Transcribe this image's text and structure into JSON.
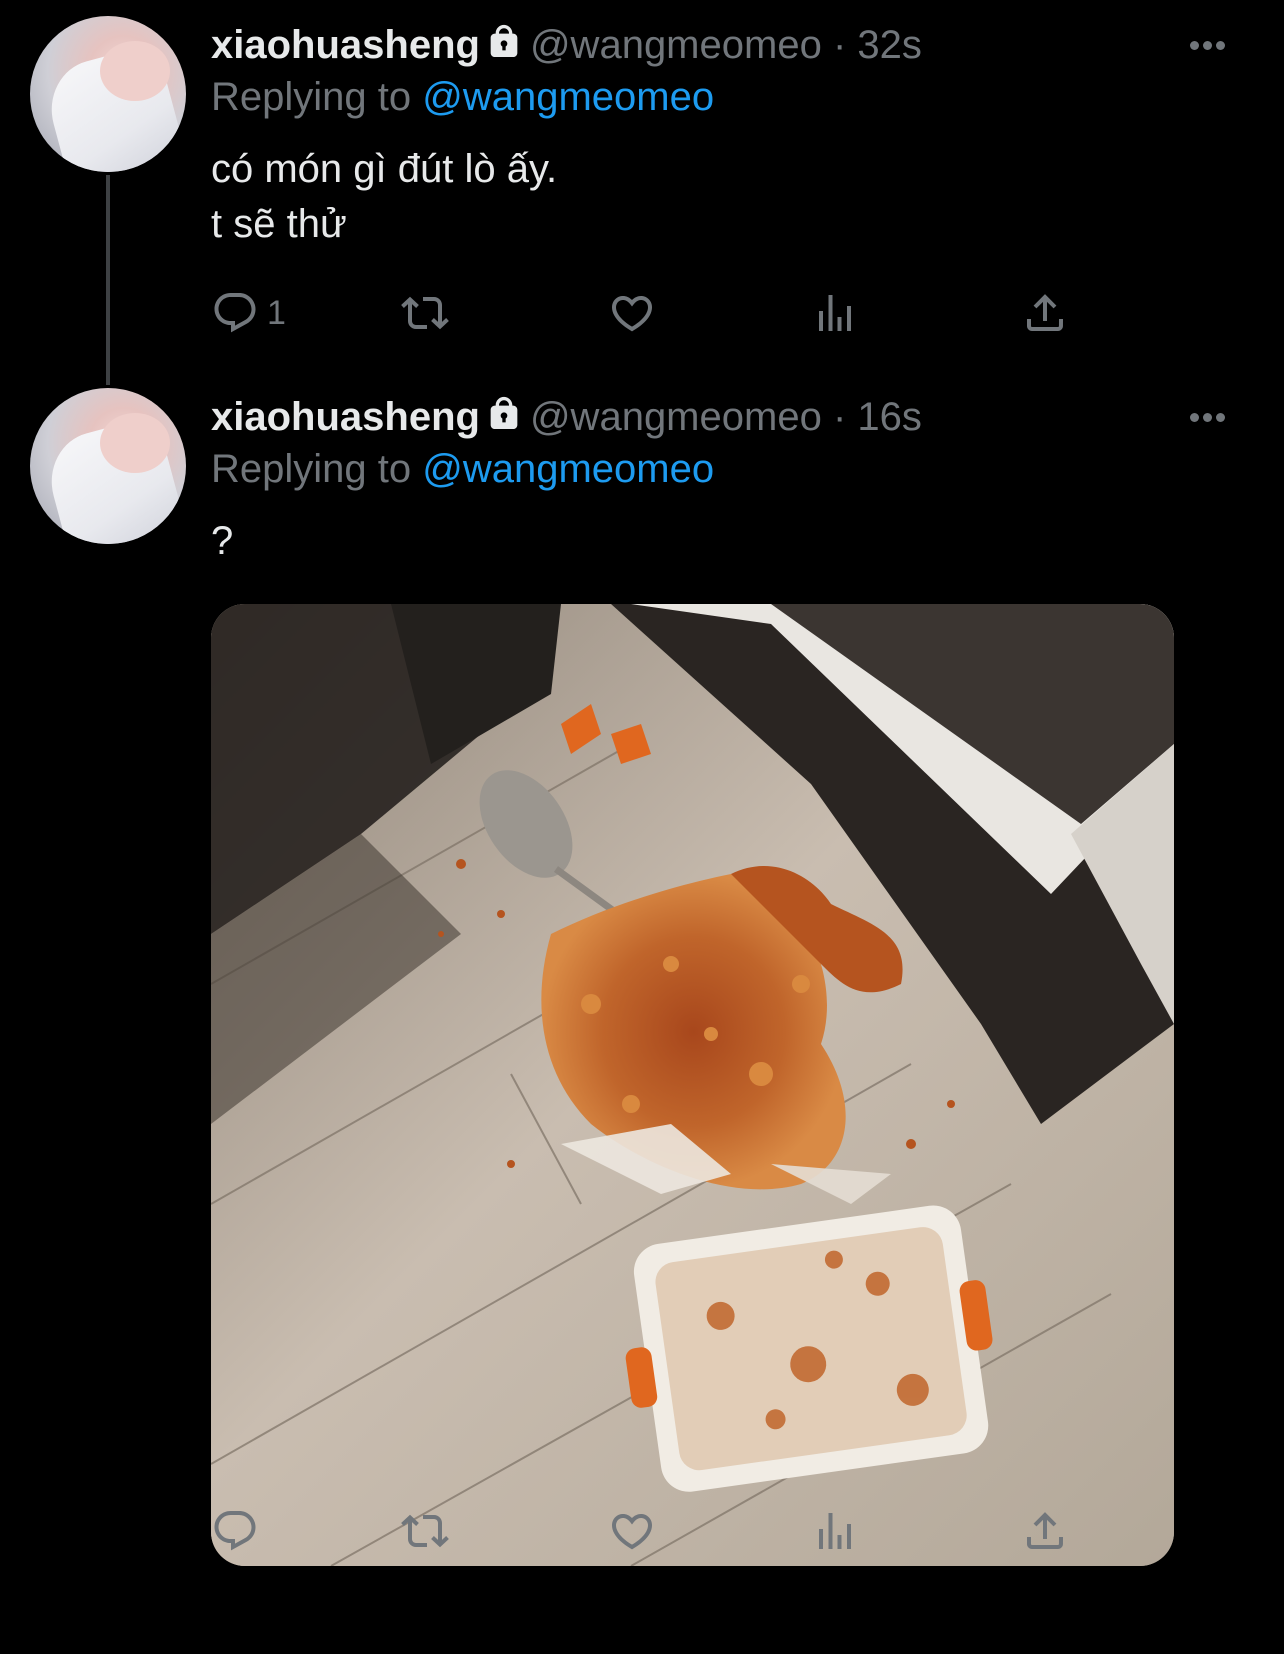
{
  "colors": {
    "background": "#000000",
    "text": "#e7e9ea",
    "muted": "#71767b",
    "accent": "#1d9bf0",
    "thread_line": "#3e4144"
  },
  "tweets": [
    {
      "display_name": "xiaohuasheng",
      "handle": "@wangmeomeo",
      "separator": "·",
      "time": "32s",
      "replying_prefix": "Replying to",
      "replying_to": "@wangmeomeo",
      "text": "có món gì đút lò ấy.\nt sẽ thử",
      "reply_count": "1",
      "icons": [
        "lock-icon",
        "more-icon",
        "reply-icon",
        "retweet-icon",
        "like-icon",
        "analytics-icon",
        "share-icon"
      ]
    },
    {
      "display_name": "xiaohuasheng",
      "handle": "@wangmeomeo",
      "separator": "·",
      "time": "16s",
      "replying_prefix": "Replying to",
      "replying_to": "@wangmeomeo",
      "text": "?",
      "media": "photo of a spilled baked dish on a wooden floor beside an oven",
      "icons": [
        "lock-icon",
        "more-icon",
        "reply-icon",
        "retweet-icon",
        "like-icon",
        "analytics-icon",
        "share-icon"
      ]
    }
  ]
}
